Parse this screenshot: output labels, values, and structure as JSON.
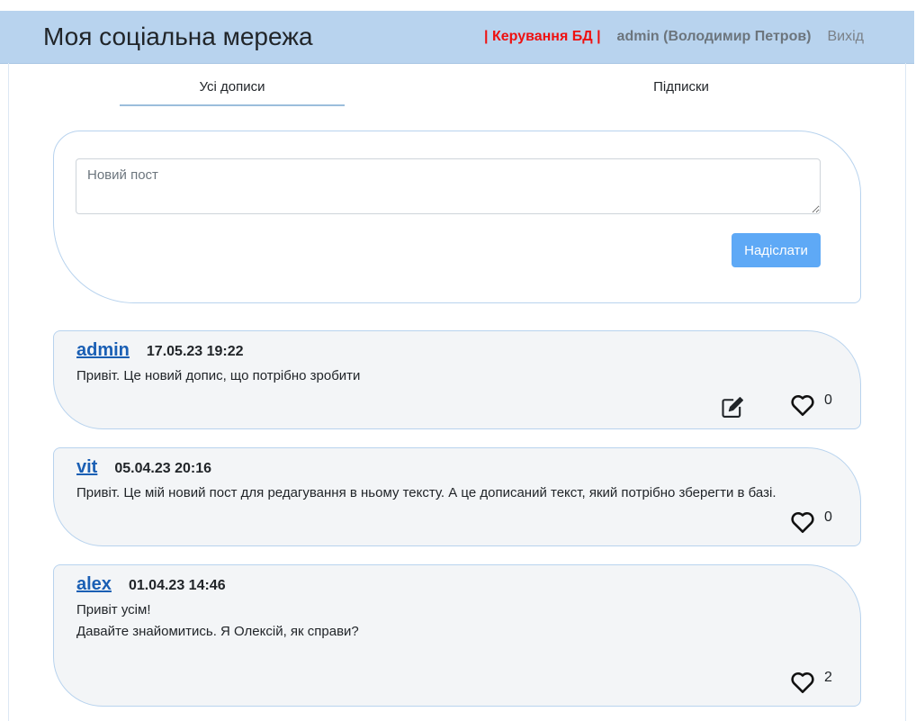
{
  "header": {
    "title": "Моя соціальна мережа",
    "admin_link": "| Керування БД |",
    "user": "admin (Володимир Петров)",
    "logout": "Вихід"
  },
  "tabs": [
    {
      "label": "Усі дописи",
      "active": true
    },
    {
      "label": "Підписки",
      "active": false
    }
  ],
  "new_post": {
    "placeholder": "Новий пост",
    "value": "",
    "submit_label": "Надіслати"
  },
  "posts": [
    {
      "author": "admin",
      "date": "17.05.23 19:22",
      "lines": [
        "Привіт. Це новий допис, що потрібно зробити"
      ],
      "likes": "0",
      "editable": true
    },
    {
      "author": "vit",
      "date": "05.04.23 20:16",
      "lines": [
        "Привіт. Це мій новий пост для редагування в ньому тексту. А це дописаний текст, який потрібно зберегти в базі."
      ],
      "likes": "0",
      "editable": false
    },
    {
      "author": "alex",
      "date": "01.04.23 14:46",
      "lines": [
        "Привіт усім!",
        "Давайте знайомитись. Я Олексій, як справи?"
      ],
      "likes": "2",
      "editable": false
    }
  ],
  "colors": {
    "navbar": "#b8d3ee",
    "admin_link": "#ee1111",
    "button": "#5ea9f6",
    "post_bg": "#f3f5f7",
    "author_link": "#1a5fb4"
  },
  "icons": {
    "edit": "pencil-square-icon",
    "like": "heart-outline-icon"
  }
}
